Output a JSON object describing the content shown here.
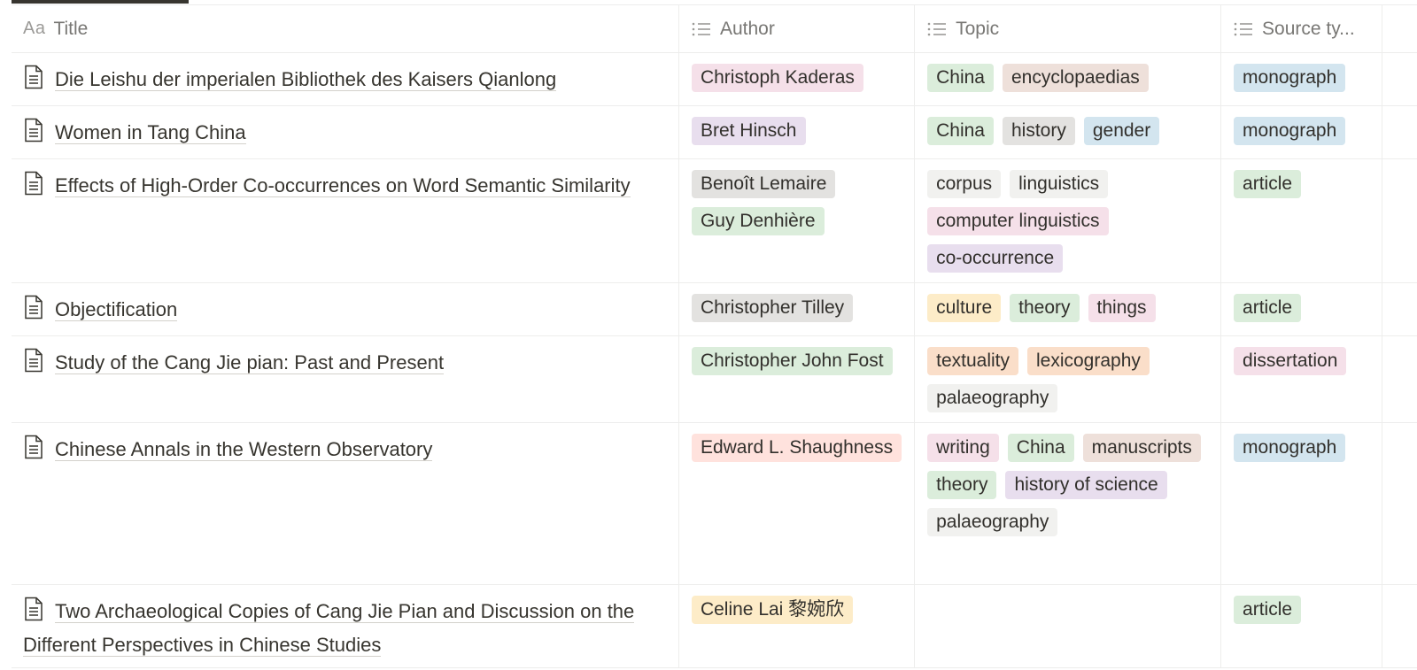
{
  "columns": [
    {
      "key": "title",
      "label": "Title",
      "icon": "text-aa-icon"
    },
    {
      "key": "author",
      "label": "Author",
      "icon": "list-icon"
    },
    {
      "key": "topic",
      "label": "Topic",
      "icon": "list-icon"
    },
    {
      "key": "source",
      "label": "Source ty...",
      "icon": "list-icon"
    }
  ],
  "tag_colors": {
    "pink": "#f5e0e9",
    "purple": "#e8deee",
    "gray": "#e3e2e0",
    "lightgray": "#f1f1ef",
    "green": "#dbeddb",
    "brown": "#eee0da",
    "blue": "#d3e5ef",
    "yellow": "#fdecc8",
    "orange": "#fadec9",
    "red": "#ffe2dd"
  },
  "rows": [
    {
      "title": "Die Leishu der imperialen Bibliothek des Kaisers Qianlong",
      "authors": [
        {
          "label": "Christoph Kaderas",
          "color": "pink"
        }
      ],
      "topics": [
        {
          "label": "China",
          "color": "green"
        },
        {
          "label": "encyclopaedias",
          "color": "brown"
        }
      ],
      "source": {
        "label": "monograph",
        "color": "blue"
      }
    },
    {
      "title": "Women in Tang China",
      "authors": [
        {
          "label": "Bret Hinsch",
          "color": "purple"
        }
      ],
      "topics": [
        {
          "label": "China",
          "color": "green"
        },
        {
          "label": "history",
          "color": "gray"
        },
        {
          "label": "gender",
          "color": "blue"
        }
      ],
      "source": {
        "label": "monograph",
        "color": "blue"
      }
    },
    {
      "title": "Effects of High-Order Co-occurrences on Word Semantic Similarity",
      "authors": [
        {
          "label": "Benoît Lemaire",
          "color": "gray"
        },
        {
          "label": "Guy Denhière",
          "color": "green"
        }
      ],
      "topics": [
        {
          "label": "corpus",
          "color": "lightgray"
        },
        {
          "label": "linguistics",
          "color": "lightgray"
        },
        {
          "label": "computer linguistics",
          "color": "pink"
        },
        {
          "label": "co-occurrence",
          "color": "purple"
        }
      ],
      "source": {
        "label": "article",
        "color": "green"
      }
    },
    {
      "title": "Objectification",
      "authors": [
        {
          "label": "Christopher Tilley",
          "color": "gray"
        }
      ],
      "topics": [
        {
          "label": "culture",
          "color": "yellow"
        },
        {
          "label": "theory",
          "color": "green"
        },
        {
          "label": "things",
          "color": "pink"
        }
      ],
      "source": {
        "label": "article",
        "color": "green"
      }
    },
    {
      "title": "Study of the Cang Jie pian: Past and Present",
      "authors": [
        {
          "label": "Christopher John Fost",
          "color": "green"
        }
      ],
      "topics": [
        {
          "label": "textuality",
          "color": "orange"
        },
        {
          "label": "lexicography",
          "color": "orange"
        },
        {
          "label": "palaeography",
          "color": "lightgray"
        }
      ],
      "source": {
        "label": "dissertation",
        "color": "pink"
      }
    },
    {
      "title": "Chinese Annals in the Western Observatory",
      "authors": [
        {
          "label": "Edward L. Shaughness",
          "color": "red"
        }
      ],
      "topics": [
        {
          "label": "writing",
          "color": "pink"
        },
        {
          "label": "China",
          "color": "green"
        },
        {
          "label": "manuscripts",
          "color": "brown"
        },
        {
          "label": "theory",
          "color": "green"
        },
        {
          "label": "history of science",
          "color": "purple"
        },
        {
          "label": "palaeography",
          "color": "lightgray"
        }
      ],
      "source": {
        "label": "monograph",
        "color": "blue"
      }
    },
    {
      "title": "Two Archaeological Copies of Cang Jie Pian and Discussion on the Different Perspectives in Chinese Studies",
      "authors": [
        {
          "label": "Celine Lai 黎婉欣",
          "color": "yellow"
        }
      ],
      "topics": [],
      "source": {
        "label": "article",
        "color": "green"
      }
    }
  ]
}
